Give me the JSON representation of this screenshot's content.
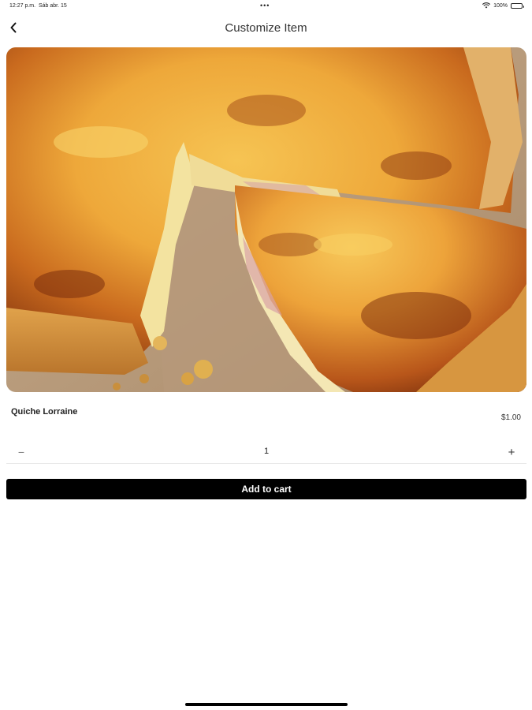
{
  "status_bar": {
    "time": "12:27 p.m.",
    "date": "Sáb abr. 15",
    "center_dots": "•••",
    "battery_text": "100%",
    "icons": [
      "wifi-icon",
      "battery-icon"
    ]
  },
  "nav": {
    "title": "Customize Item",
    "back_icon": "chevron-left-icon"
  },
  "item": {
    "image_subject": "quiche-photo",
    "name": "Quiche Lorraine",
    "price": "$1.00"
  },
  "quantity": {
    "minus_label": "−",
    "value": "1",
    "plus_label": "+"
  },
  "actions": {
    "add_to_cart_label": "Add to cart",
    "button_color": "#000000"
  }
}
